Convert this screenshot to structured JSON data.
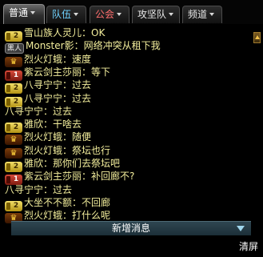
{
  "tabs": [
    {
      "label": "普通",
      "color": "#ffffff",
      "active": true
    },
    {
      "label": "队伍",
      "color": "#6fd3ff",
      "active": false
    },
    {
      "label": "公会",
      "color": "#ff6e6e",
      "active": false
    },
    {
      "label": "攻坚队",
      "color": "#e7e7e7",
      "active": false
    },
    {
      "label": "频道",
      "color": "#e7e7e7",
      "active": false
    }
  ],
  "chat": [
    {
      "badge": "num",
      "badge_text": "2",
      "name": "雪山族人灵儿",
      "sep": "：",
      "text": "OK",
      "color": "#f3ee9c"
    },
    {
      "badge": "team",
      "badge_text": "黑人",
      "name": "Monster影",
      "sep": "：",
      "text": "网络冲突从租下我",
      "color": "#f3ee9c"
    },
    {
      "badge": "crown",
      "badge_text": "♛",
      "name": "烈火灯蛾",
      "sep": "：",
      "text": "速度",
      "color": "#f3ee9c"
    },
    {
      "badge": "red",
      "badge_text": "1",
      "name": "紫云剑主莎丽",
      "sep": "：",
      "text": "等下",
      "color": "#f3ee9c"
    },
    {
      "badge": "num",
      "badge_text": "2",
      "name": "八寻宁宁",
      "sep": "：",
      "text": "过去",
      "color": "#f3ee9c"
    },
    {
      "badge": "num",
      "badge_text": "2",
      "name": "八寻宁宁",
      "sep": "：",
      "text": "过去",
      "color": "#f3ee9c"
    },
    {
      "badge": "",
      "badge_text": "",
      "name": "八寻宁宁",
      "sep": "：",
      "text": "过去",
      "color": "#f3ee9c"
    },
    {
      "badge": "num",
      "badge_text": "2",
      "name": "雅欣",
      "sep": "：",
      "text": "干啥去",
      "color": "#f3ee9c"
    },
    {
      "badge": "crown",
      "badge_text": "♛",
      "name": "烈火灯蛾",
      "sep": "：",
      "text": "随便",
      "color": "#f3ee9c"
    },
    {
      "badge": "crown",
      "badge_text": "♛",
      "name": "烈火灯蛾",
      "sep": "：",
      "text": "祭坛也行",
      "color": "#f3ee9c"
    },
    {
      "badge": "num",
      "badge_text": "2",
      "name": "雅欣",
      "sep": "：",
      "text": "那你们去祭坛吧",
      "color": "#f3ee9c"
    },
    {
      "badge": "red",
      "badge_text": "1",
      "name": "紫云剑主莎丽",
      "sep": "：",
      "text": "补回廊不?",
      "color": "#f3ee9c"
    },
    {
      "badge": "",
      "badge_text": "",
      "name": "八寻宁宁",
      "sep": "：",
      "text": "过去",
      "color": "#f3ee9c"
    },
    {
      "badge": "num",
      "badge_text": "2",
      "name": "大坐不不额",
      "sep": "：",
      "text": "不回廊",
      "color": "#f3ee9c"
    },
    {
      "badge": "crown",
      "badge_text": "♛",
      "name": "烈火灯蛾",
      "sep": "：",
      "text": "打什么呢",
      "color": "#f3ee9c"
    }
  ],
  "new_message_label": "新增消息",
  "clear_label": "清屏"
}
